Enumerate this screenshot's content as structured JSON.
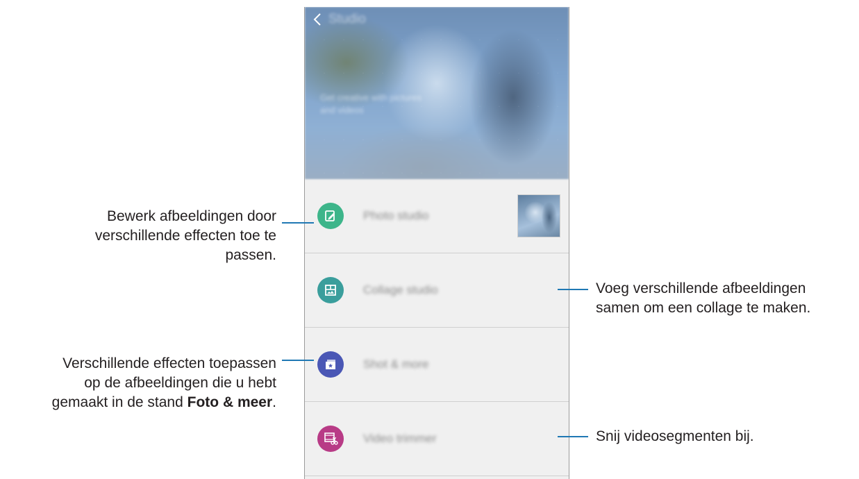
{
  "app": {
    "title": "Studio",
    "hero_caption": "Get creative with pictures and videos"
  },
  "items": [
    {
      "label": "Photo studio",
      "icon": "photo-edit-icon",
      "color": "#3db58a"
    },
    {
      "label": "Collage studio",
      "icon": "collage-icon",
      "color": "#3a9e9c"
    },
    {
      "label": "Shot & more",
      "icon": "shot-more-icon",
      "color": "#4a57b5"
    },
    {
      "label": "Video trimmer",
      "icon": "video-trim-icon",
      "color": "#b83b86"
    }
  ],
  "annotations": {
    "photo": {
      "line1": "Bewerk afbeeldingen door",
      "line2": "verschillende effecten toe te",
      "line3": "passen."
    },
    "collage": {
      "line1": "Voeg verschillende afbeeldingen",
      "line2": "samen om een collage te maken."
    },
    "shot": {
      "line1": "Verschillende effecten toepassen",
      "line2": "op de afbeeldingen die u hebt",
      "line3_prefix": "gemaakt in de stand ",
      "line3_bold": "Foto & meer",
      "line3_suffix": "."
    },
    "video": {
      "line1": "Snij videosegmenten bij."
    }
  },
  "colors": {
    "leader": "#1f78b4"
  }
}
